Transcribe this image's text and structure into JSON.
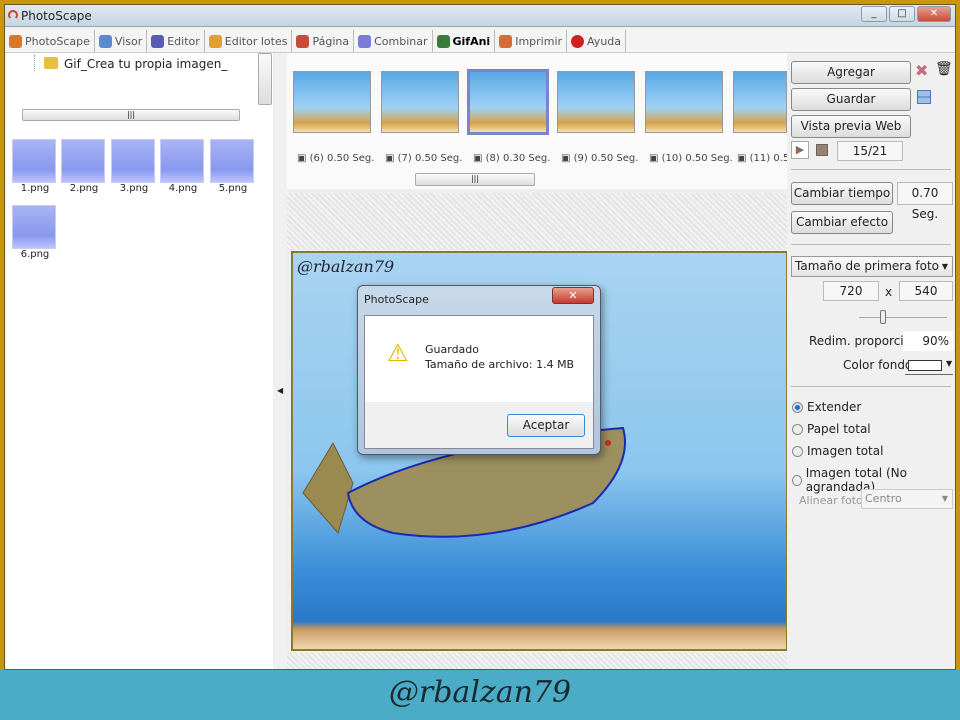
{
  "window": {
    "title": "PhotoScape",
    "controls": [
      "_",
      "□",
      "✕"
    ]
  },
  "tabs": [
    {
      "label": "PhotoScape",
      "color": "#d9772a"
    },
    {
      "label": "Visor",
      "color": "#5a8ad0"
    },
    {
      "label": "Editor",
      "color": "#5a5ab8"
    },
    {
      "label": "Editor lotes",
      "color": "#e2a030"
    },
    {
      "label": "Página",
      "color": "#c84a3a"
    },
    {
      "label": "Combinar",
      "color": "#7a7ad8"
    },
    {
      "label": "GifAni",
      "color": "#3a7a3a",
      "active": true
    },
    {
      "label": "Imprimir",
      "color": "#d86a3a"
    },
    {
      "label": "Ayuda",
      "color": "#d02020"
    }
  ],
  "tree": {
    "folder": "Gif_Crea tu propia imagen_"
  },
  "files": [
    "1.png",
    "2.png",
    "3.png",
    "4.png",
    "5.png",
    "6.png"
  ],
  "frames": [
    {
      "label": "(6) 0.50 Seg."
    },
    {
      "label": "(7) 0.50 Seg."
    },
    {
      "label": "(8) 0.30 Seg.",
      "selected": true
    },
    {
      "label": "(9) 0.50 Seg."
    },
    {
      "label": "(10) 0.50 Seg."
    },
    {
      "label": "(11) 0.5"
    }
  ],
  "preview": {
    "watermark": "@rbalzan79"
  },
  "right": {
    "add": "Agregar",
    "save": "Guardar",
    "web_preview": "Vista previa Web",
    "frame_counter": "15/21",
    "change_time": "Cambiar tiempo",
    "time_value": "0.70 Seg.",
    "change_effect": "Cambiar efecto",
    "size_select": "Tamaño de primera foto",
    "width": "720",
    "x": "x",
    "height": "540",
    "resize_label": "Redim. proporción",
    "resize_value": "90%",
    "bg_label": "Color fondo",
    "bg_color": "#ffffff",
    "options": [
      {
        "label": "Extender",
        "checked": true
      },
      {
        "label": "Papel total"
      },
      {
        "label": "Imagen total"
      },
      {
        "label": "Imagen total (No agrandada)"
      }
    ],
    "align_label": "Alinear foto",
    "align_value": "Centro"
  },
  "dialog": {
    "title": "PhotoScape",
    "line1": "Guardado",
    "line2": "Tamaño de archivo: 1.4 MB",
    "ok": "Aceptar"
  },
  "banner": {
    "text": "@rbalzan79"
  }
}
